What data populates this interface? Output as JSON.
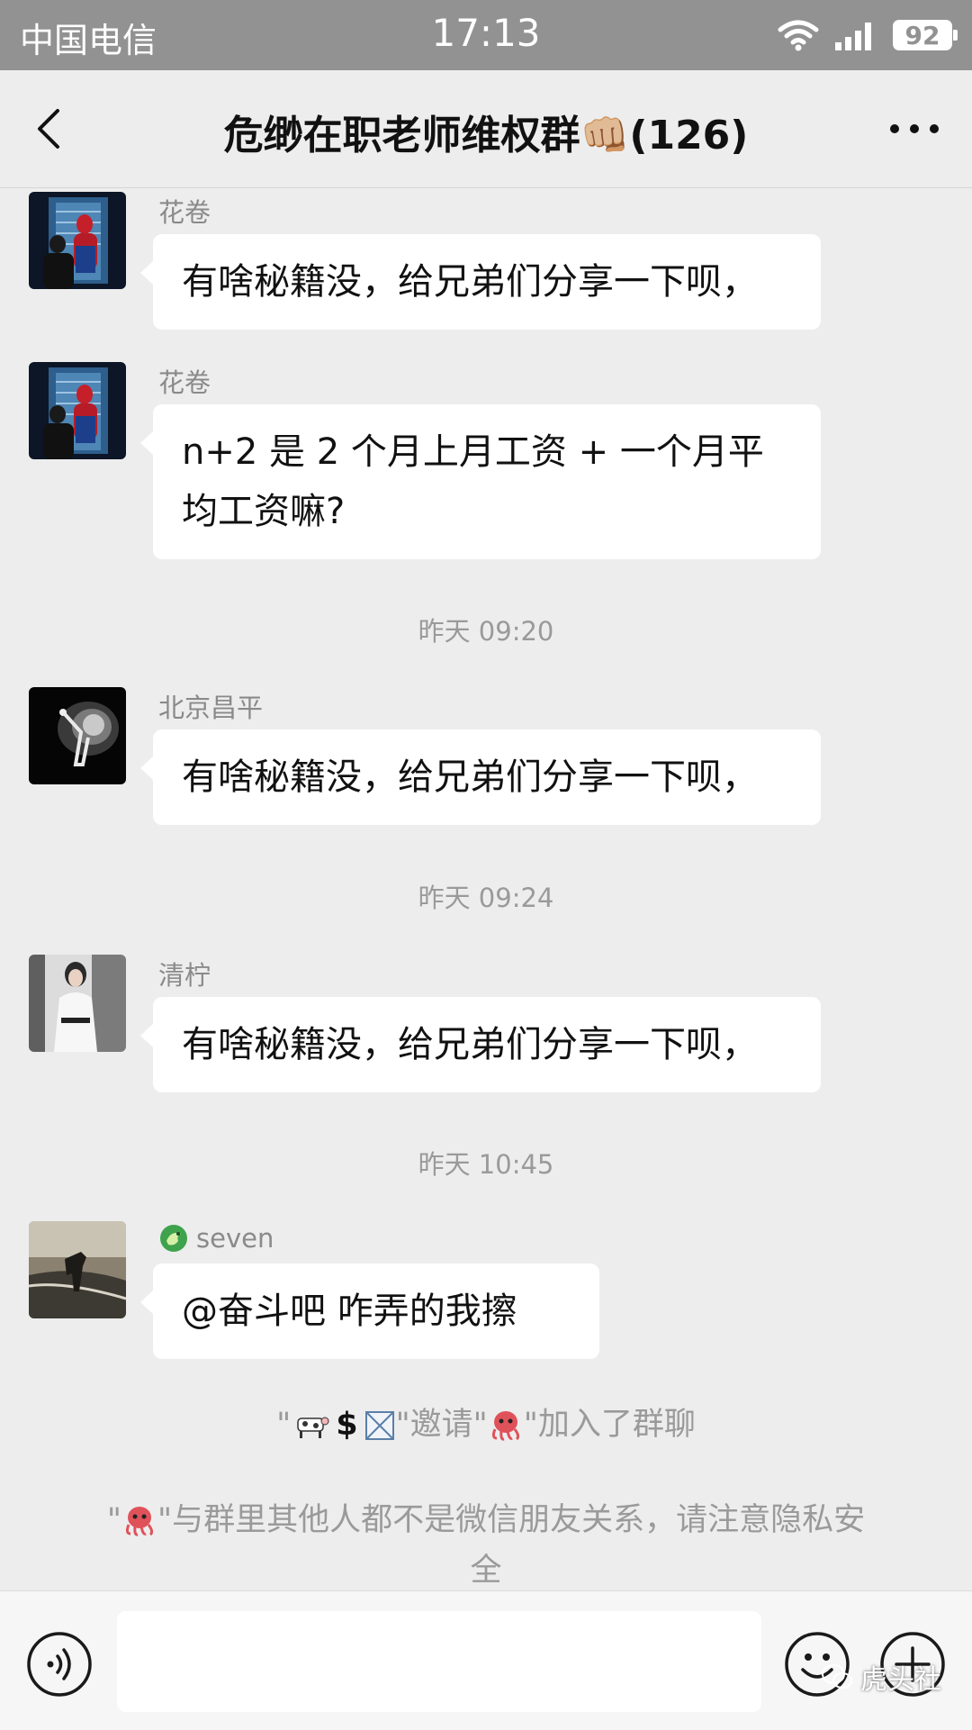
{
  "status_bar": {
    "carrier": "中国电信",
    "time": "17:13",
    "battery": "92"
  },
  "nav": {
    "title": "危缈在职老师维权群👊🏼(126)"
  },
  "messages": [
    {
      "sender": "花卷",
      "text": "有啥秘籍没，给兄弟们分享一下呗，",
      "avatar": "spiderman-avatar"
    },
    {
      "sender": "花卷",
      "text_line1": "n+2 是 2 个月上月工资 + 一个月平",
      "text_line2": "均工资嘛?",
      "avatar": "spiderman-avatar"
    },
    {
      "sender": "北京昌平",
      "text": "有啥秘籍没，给兄弟们分享一下呗，",
      "avatar": "dancer-avatar"
    },
    {
      "sender": "清柠",
      "text": "有啥秘籍没，给兄弟们分享一下呗，",
      "avatar": "woman-avatar"
    },
    {
      "sender": "seven",
      "text": "@奋斗吧  咋弄的我擦",
      "avatar": "horse-avatar",
      "sender_icon": "dragon-icon"
    }
  ],
  "timestamps": [
    "昨天 09:20",
    "昨天 09:24",
    "昨天 10:45"
  ],
  "system": {
    "invite_q1": "\"",
    "invite_symbols": "$",
    "invite_mid": "\"邀请\"",
    "invite_end": "\"加入了群聊",
    "privacy_q": "\"",
    "privacy_text": "\"与群里其他人都不是微信朋友关系，请注意隐私安",
    "privacy_text2": "全"
  },
  "watermark": "虎头社",
  "colors": {
    "background": "#ededed",
    "bubble": "#ffffff",
    "status_bar": "#929292",
    "meta_text": "#9a9a9a"
  }
}
